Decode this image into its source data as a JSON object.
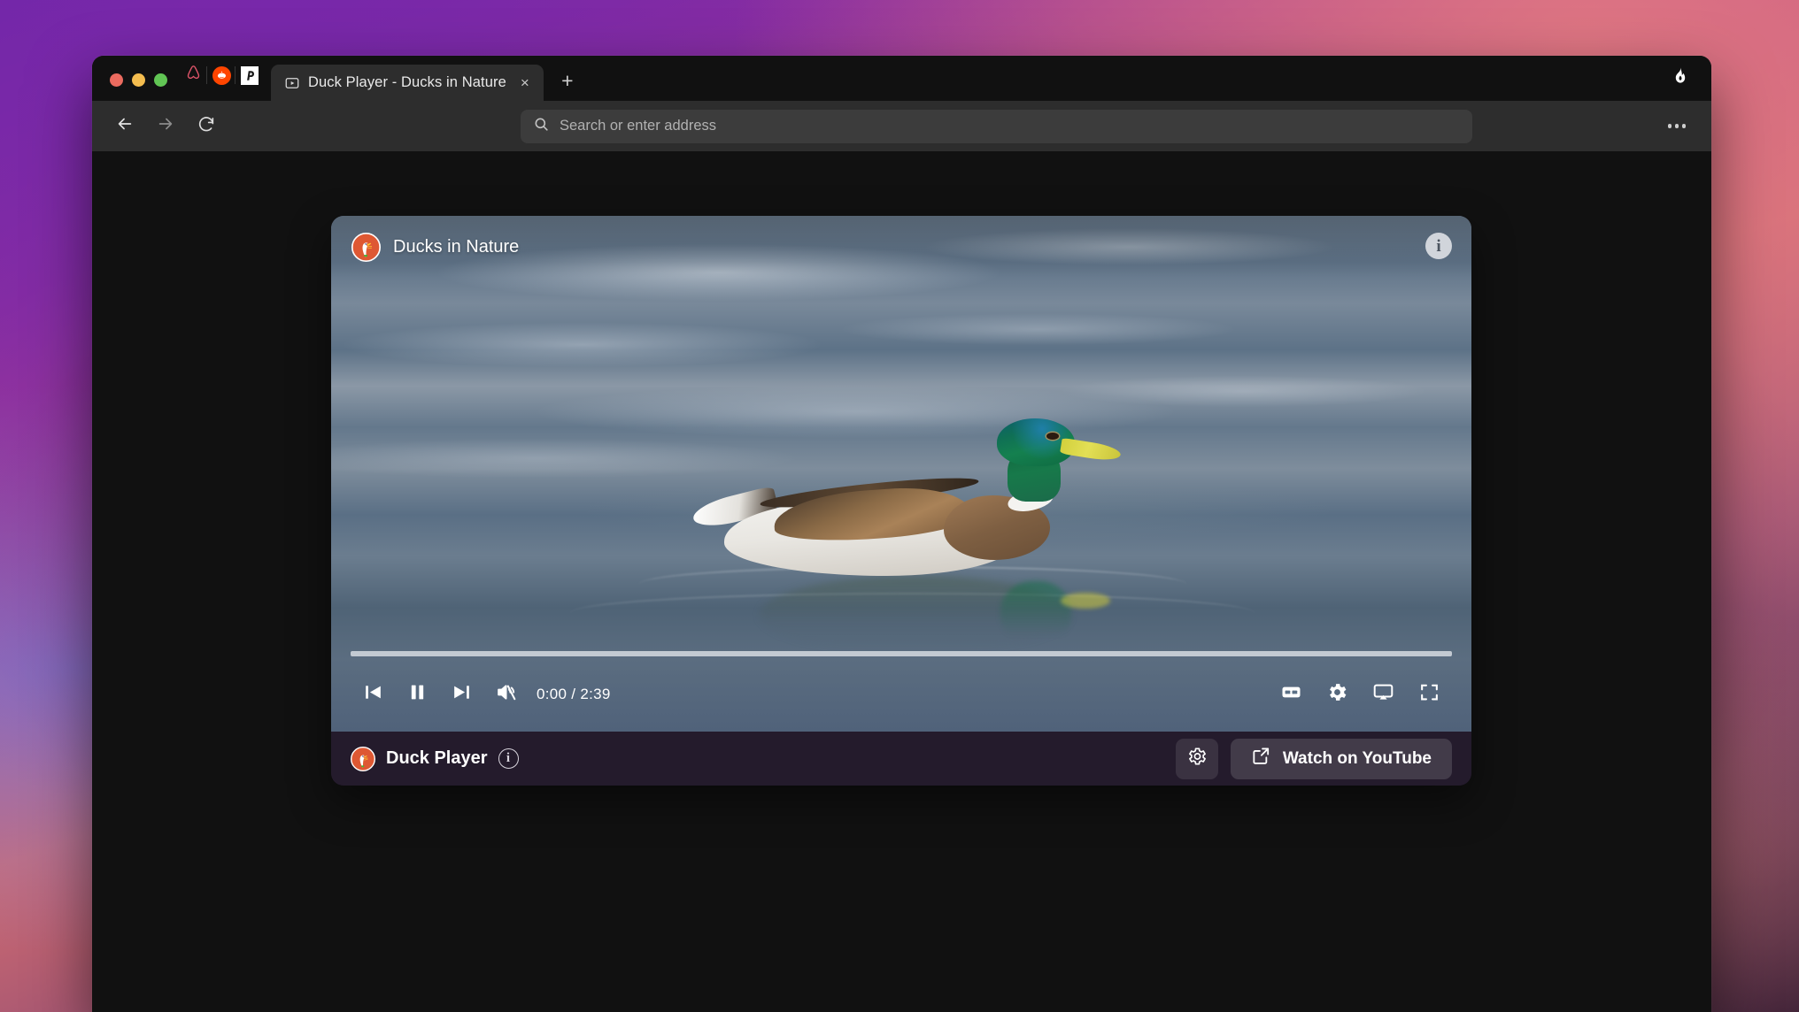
{
  "window": {
    "traffic_lights": [
      "close",
      "minimize",
      "maximize"
    ],
    "pinned_tabs": [
      {
        "name": "airbnb",
        "label": "Airbnb"
      },
      {
        "name": "reddit",
        "label": "Reddit"
      },
      {
        "name": "peacock",
        "label": "Peacock"
      }
    ],
    "active_tab": {
      "title": "Duck Player - Ducks in Nature",
      "close_label": "×"
    },
    "new_tab_label": "+",
    "fire_button_label": "Fire Button"
  },
  "toolbar": {
    "back_label": "Back",
    "forward_label": "Forward",
    "reload_label": "Reload",
    "address_placeholder": "Search or enter address",
    "address_value": "",
    "menu_label": "Browser Menu"
  },
  "player": {
    "video_title": "Ducks in Nature",
    "info_label": "i",
    "controls": {
      "previous_label": "Previous",
      "play_pause_label": "Pause",
      "next_label": "Next",
      "mute_label": "Unmute",
      "current_time": "0:00",
      "separator": "/",
      "duration": "2:39",
      "timecode": "0:00 / 2:39",
      "captions_label": "CC",
      "settings_label": "Settings",
      "cast_label": "Cast",
      "fullscreen_label": "Fullscreen",
      "progress_percent": 0
    },
    "bottom_bar": {
      "brand_name": "Duck Player",
      "brand_info_label": "i",
      "settings_label": "Settings",
      "watch_label": "Watch on YouTube"
    }
  },
  "colors": {
    "accent_red": "#e8362e",
    "ddg_orange": "#de5833",
    "reddit_orange": "#ff4500",
    "card_bg": "#241b2c",
    "toolbar_bg": "#2d2d2d"
  }
}
